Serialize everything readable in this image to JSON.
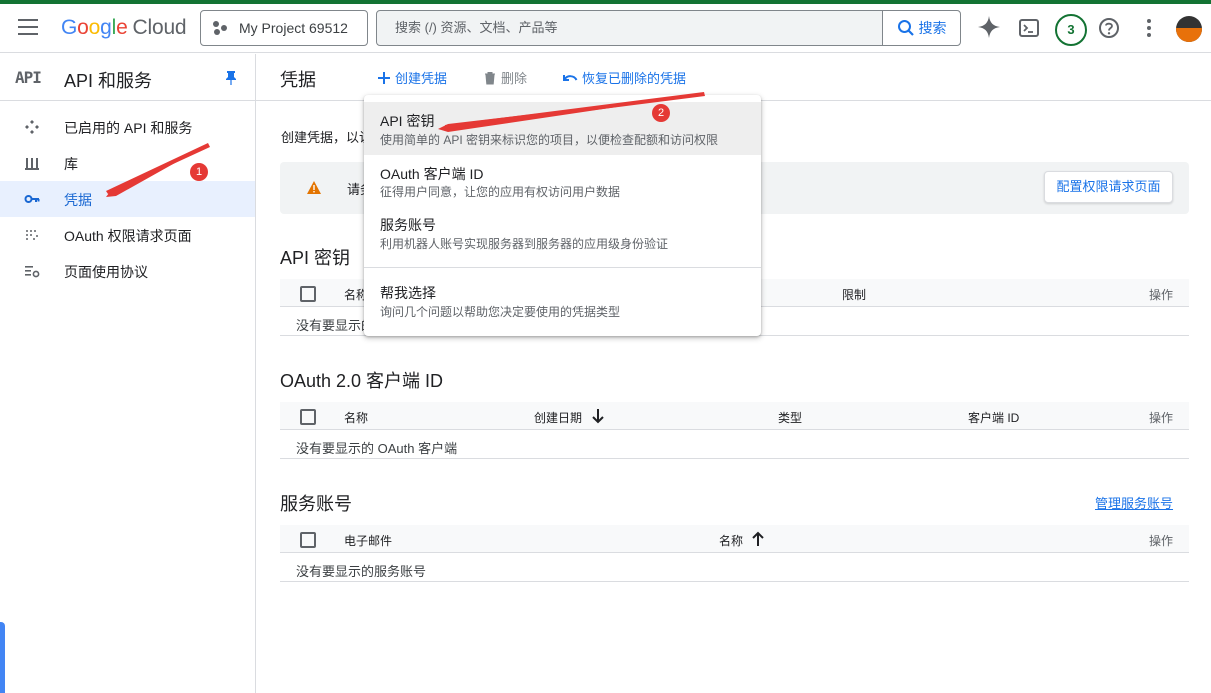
{
  "topbar": {
    "logo_letters": [
      "G",
      "o",
      "o",
      "g",
      "l",
      "e"
    ],
    "logo_suffix": "Cloud",
    "project_name": "My Project 69512",
    "search_placeholder": "搜索 (/) 资源、文档、产品等",
    "search_button": "搜索",
    "notification_count": "3",
    "accent_color": "#137333"
  },
  "sidebar": {
    "logo": "API",
    "title": "API 和服务",
    "items": [
      {
        "label": "已启用的 API 和服务",
        "icon": "api-diamond-icon"
      },
      {
        "label": "库",
        "icon": "library-icon"
      },
      {
        "label": "凭据",
        "icon": "key-icon",
        "active": true
      },
      {
        "label": "OAuth 权限请求页面",
        "icon": "oauth-icon"
      },
      {
        "label": "页面使用协议",
        "icon": "settings-list-icon"
      }
    ]
  },
  "header": {
    "title": "凭据",
    "create_label": "创建凭据",
    "delete_label": "删除",
    "restore_label": "恢复已删除的凭据"
  },
  "main": {
    "intro": "创建凭据，以访",
    "warning_text": "请务",
    "config_button": "配置权限请求页面"
  },
  "dropdown": {
    "items": [
      {
        "title": "API 密钥",
        "desc": "使用简单的 API 密钥来标识您的项目，以便检查配额和访问权限"
      },
      {
        "title": "OAuth 客户端 ID",
        "desc": "征得用户同意，让您的应用有权访问用户数据"
      },
      {
        "title": "服务账号",
        "desc": "利用机器人账号实现服务器到服务器的应用级身份验证"
      },
      {
        "title": "帮我选择",
        "desc": "询问几个问题以帮助您决定要使用的凭据类型"
      }
    ]
  },
  "api_keys": {
    "title": "API 密钥",
    "columns": [
      "名称",
      "限制",
      "操作"
    ],
    "empty": "没有要显示的"
  },
  "oauth": {
    "title": "OAuth 2.0 客户端 ID",
    "columns": [
      "名称",
      "创建日期",
      "类型",
      "客户端 ID",
      "操作"
    ],
    "empty": "没有要显示的 OAuth 客户端"
  },
  "service_accounts": {
    "title": "服务账号",
    "manage_link": "管理服务账号",
    "columns": [
      "电子邮件",
      "名称",
      "操作"
    ],
    "empty": "没有要显示的服务账号"
  },
  "annotations": [
    "1",
    "2"
  ]
}
